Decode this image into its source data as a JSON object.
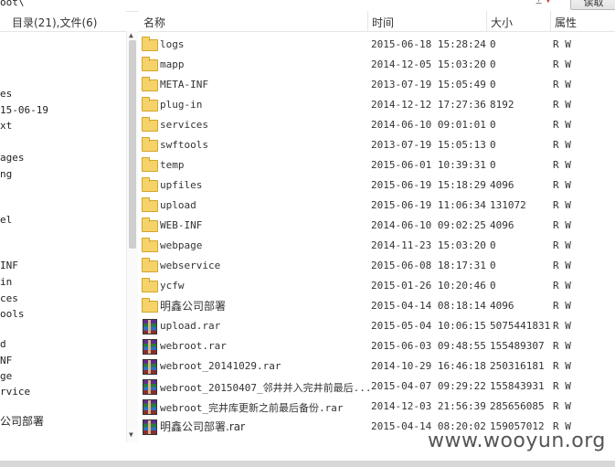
{
  "topbar": {
    "path": "oot\\",
    "read_button": "读取"
  },
  "left_panel": {
    "header": "目录(21),文件(6)",
    "tree": [
      "es",
      "15-06-19",
      "xt",
      "ages",
      "ng",
      "el",
      "INF",
      "in",
      "ces",
      "ools",
      "d",
      "NF",
      "ge",
      "rvice",
      "公司部署"
    ]
  },
  "columns": {
    "name": "名称",
    "time": "时间",
    "size": "大小",
    "attr": "属性"
  },
  "files": [
    {
      "icon": "folder-icon",
      "name": "logs",
      "time": "2015-06-18 15:28:24",
      "size": "0",
      "attr": "R W"
    },
    {
      "icon": "folder-icon",
      "name": "mapp",
      "time": "2014-12-05 15:03:20",
      "size": "0",
      "attr": "R W"
    },
    {
      "icon": "folder-icon",
      "name": "META-INF",
      "time": "2013-07-19 15:05:49",
      "size": "0",
      "attr": "R W"
    },
    {
      "icon": "folder-icon",
      "name": "plug-in",
      "time": "2014-12-12 17:27:36",
      "size": "8192",
      "attr": "R W"
    },
    {
      "icon": "folder-icon",
      "name": "services",
      "time": "2014-06-10 09:01:01",
      "size": "0",
      "attr": "R W"
    },
    {
      "icon": "folder-icon",
      "name": "swftools",
      "time": "2013-07-19 15:05:13",
      "size": "0",
      "attr": "R W"
    },
    {
      "icon": "folder-icon",
      "name": "temp",
      "time": "2015-06-01 10:39:31",
      "size": "0",
      "attr": "R W"
    },
    {
      "icon": "folder-icon",
      "name": "upfiles",
      "time": "2015-06-19 15:18:29",
      "size": "4096",
      "attr": "R W"
    },
    {
      "icon": "folder-icon",
      "name": "upload",
      "time": "2015-06-19 11:06:34",
      "size": "131072",
      "attr": "R W"
    },
    {
      "icon": "folder-icon",
      "name": "WEB-INF",
      "time": "2014-06-10 09:02:25",
      "size": "4096",
      "attr": "R W"
    },
    {
      "icon": "folder-icon",
      "name": "webpage",
      "time": "2014-11-23 15:03:20",
      "size": "0",
      "attr": "R W"
    },
    {
      "icon": "folder-icon",
      "name": "webservice",
      "time": "2015-06-08 18:17:31",
      "size": "0",
      "attr": "R W"
    },
    {
      "icon": "folder-icon",
      "name": "ycfw",
      "time": "2015-01-26 10:20:46",
      "size": "0",
      "attr": "R W"
    },
    {
      "icon": "folder-icon",
      "name": "明鑫公司部署",
      "time": "2015-04-14 08:18:14",
      "size": "4096",
      "attr": "R W"
    },
    {
      "icon": "rar-icon",
      "name": "upload.rar",
      "time": "2015-05-04 10:06:15",
      "size": "5075441831",
      "attr": "R W"
    },
    {
      "icon": "rar-icon",
      "name": "webroot.rar",
      "time": "2015-06-03 09:48:55",
      "size": "155489307",
      "attr": "R W"
    },
    {
      "icon": "rar-icon",
      "name": "webroot_20141029.rar",
      "time": "2014-10-29 16:46:18",
      "size": "250316181",
      "attr": "R W"
    },
    {
      "icon": "rar-icon",
      "name": "webroot_20150407_邻井并入完井前最后...",
      "time": "2015-04-07 09:29:22",
      "size": "155843931",
      "attr": "R W"
    },
    {
      "icon": "rar-icon",
      "name": "webroot_完井库更新之前最后备份.rar",
      "time": "2014-12-03 21:56:39",
      "size": "285656085",
      "attr": "R W"
    },
    {
      "icon": "rar-icon",
      "name": "明鑫公司部署.rar",
      "time": "2015-04-14 08:20:02",
      "size": "159057012",
      "attr": "R W"
    }
  ],
  "watermark": "www.wooyun.org"
}
